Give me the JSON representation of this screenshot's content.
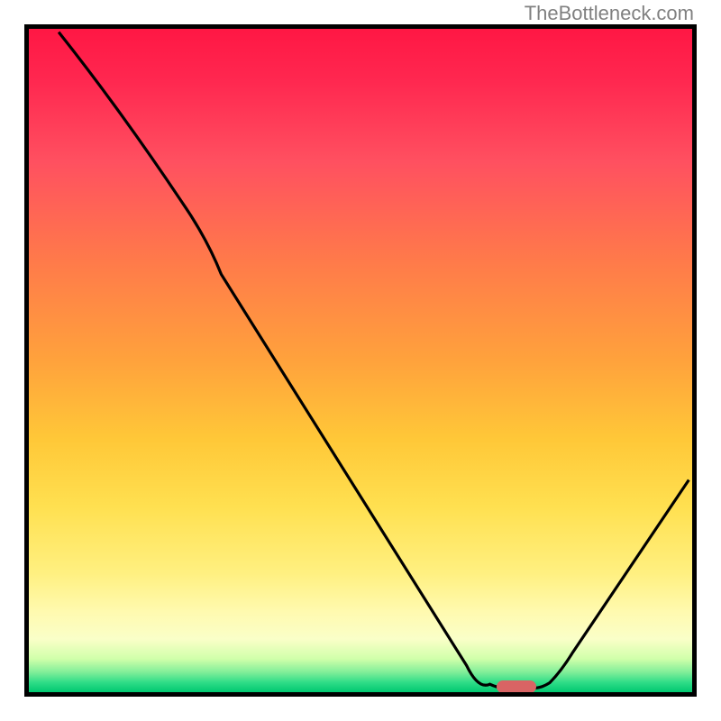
{
  "watermark": "TheBottleneck.com",
  "chart_data": {
    "type": "line",
    "title": "",
    "xlabel": "",
    "ylabel": "",
    "xlim": [
      0,
      100
    ],
    "ylim": [
      0,
      100
    ],
    "series": [
      {
        "name": "curve",
        "points": [
          {
            "x": 4.5,
            "y": 99.5
          },
          {
            "x": 23,
            "y": 74
          },
          {
            "x": 29,
            "y": 63
          },
          {
            "x": 66,
            "y": 4
          },
          {
            "x": 69.5,
            "y": 1.2
          },
          {
            "x": 72,
            "y": 0.6
          },
          {
            "x": 76,
            "y": 0.6
          },
          {
            "x": 78.5,
            "y": 1.4
          },
          {
            "x": 82,
            "y": 6
          },
          {
            "x": 99.5,
            "y": 32
          }
        ]
      }
    ],
    "marker": {
      "x": 73.5,
      "y": 0.8,
      "width": 6,
      "height": 2,
      "color": "#d96464"
    },
    "gradient": {
      "top": "#ff1744",
      "bottom": "#00c870"
    }
  }
}
